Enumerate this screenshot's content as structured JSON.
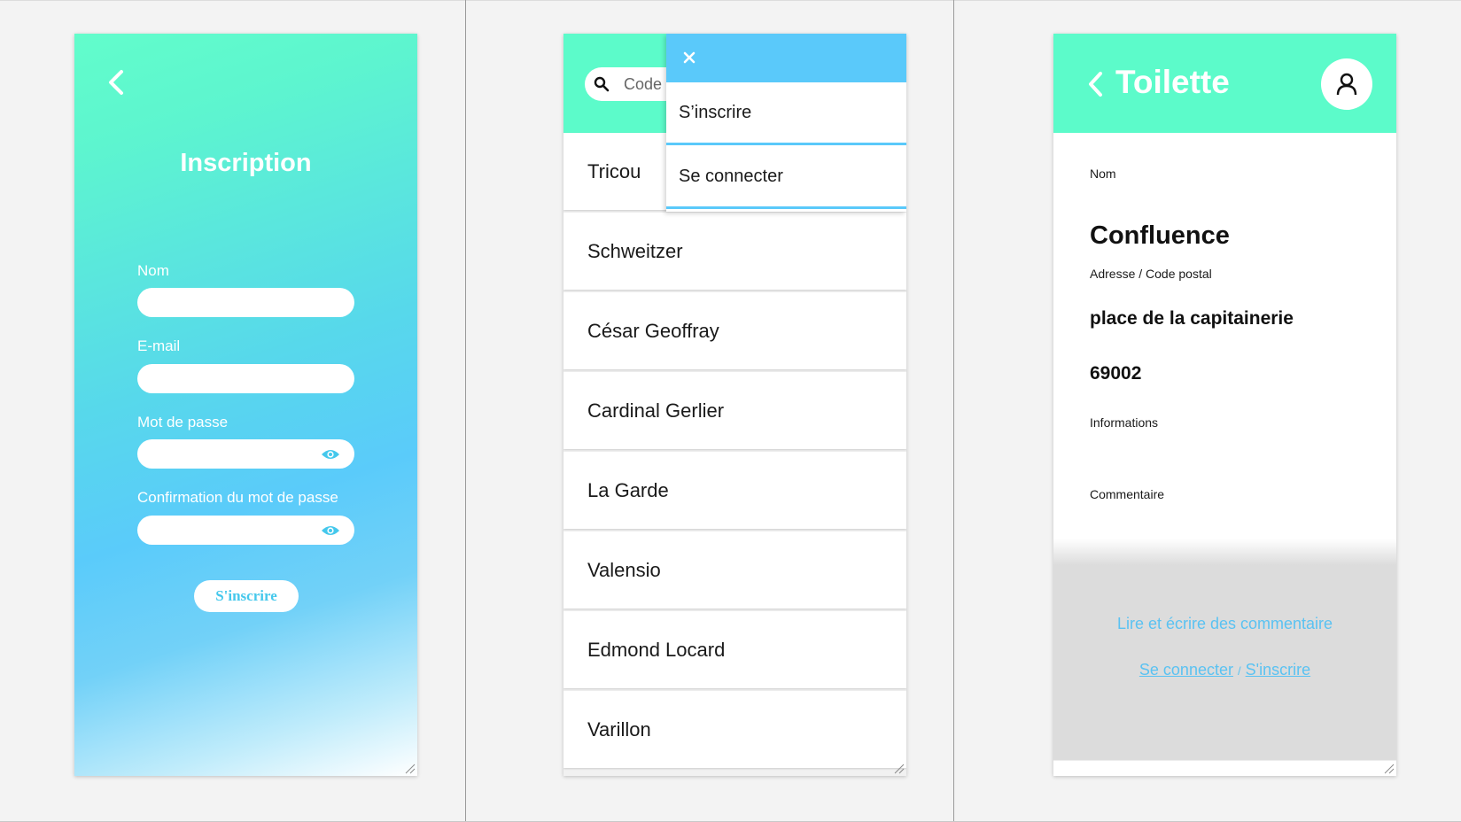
{
  "signup": {
    "title": "Inscription",
    "fields": [
      {
        "label": "Nom",
        "value": ""
      },
      {
        "label": "E-mail",
        "value": ""
      },
      {
        "label": "Mot de passe",
        "value": ""
      },
      {
        "label": "Confirmation du mot de passe",
        "value": ""
      }
    ],
    "submit_label": "S'inscrire"
  },
  "list": {
    "search_placeholder": "Code",
    "items": [
      "Tricou",
      "Schweitzer",
      "César Geoffray",
      "Cardinal Gerlier",
      "La Garde",
      "Valensio",
      "Edmond Locard",
      "Varillon"
    ],
    "menu": {
      "items": [
        "S’inscrire",
        "Se connecter"
      ]
    }
  },
  "detail": {
    "header_title": "Toilette",
    "labels": {
      "name": "Nom",
      "address": "Adresse / Code postal",
      "info": "Informations",
      "comment": "Commentaire"
    },
    "values": {
      "name": "Confluence",
      "address": "place de la capitainerie",
      "postal_code": "69002"
    },
    "comments": {
      "prompt": "Lire et écrire des commentaire",
      "login_link": "Se connecter",
      "separator": "/",
      "signup_link": "S'inscrire"
    }
  },
  "colors": {
    "accent_green": "#5cfbca",
    "accent_blue": "#5ac9fa"
  }
}
